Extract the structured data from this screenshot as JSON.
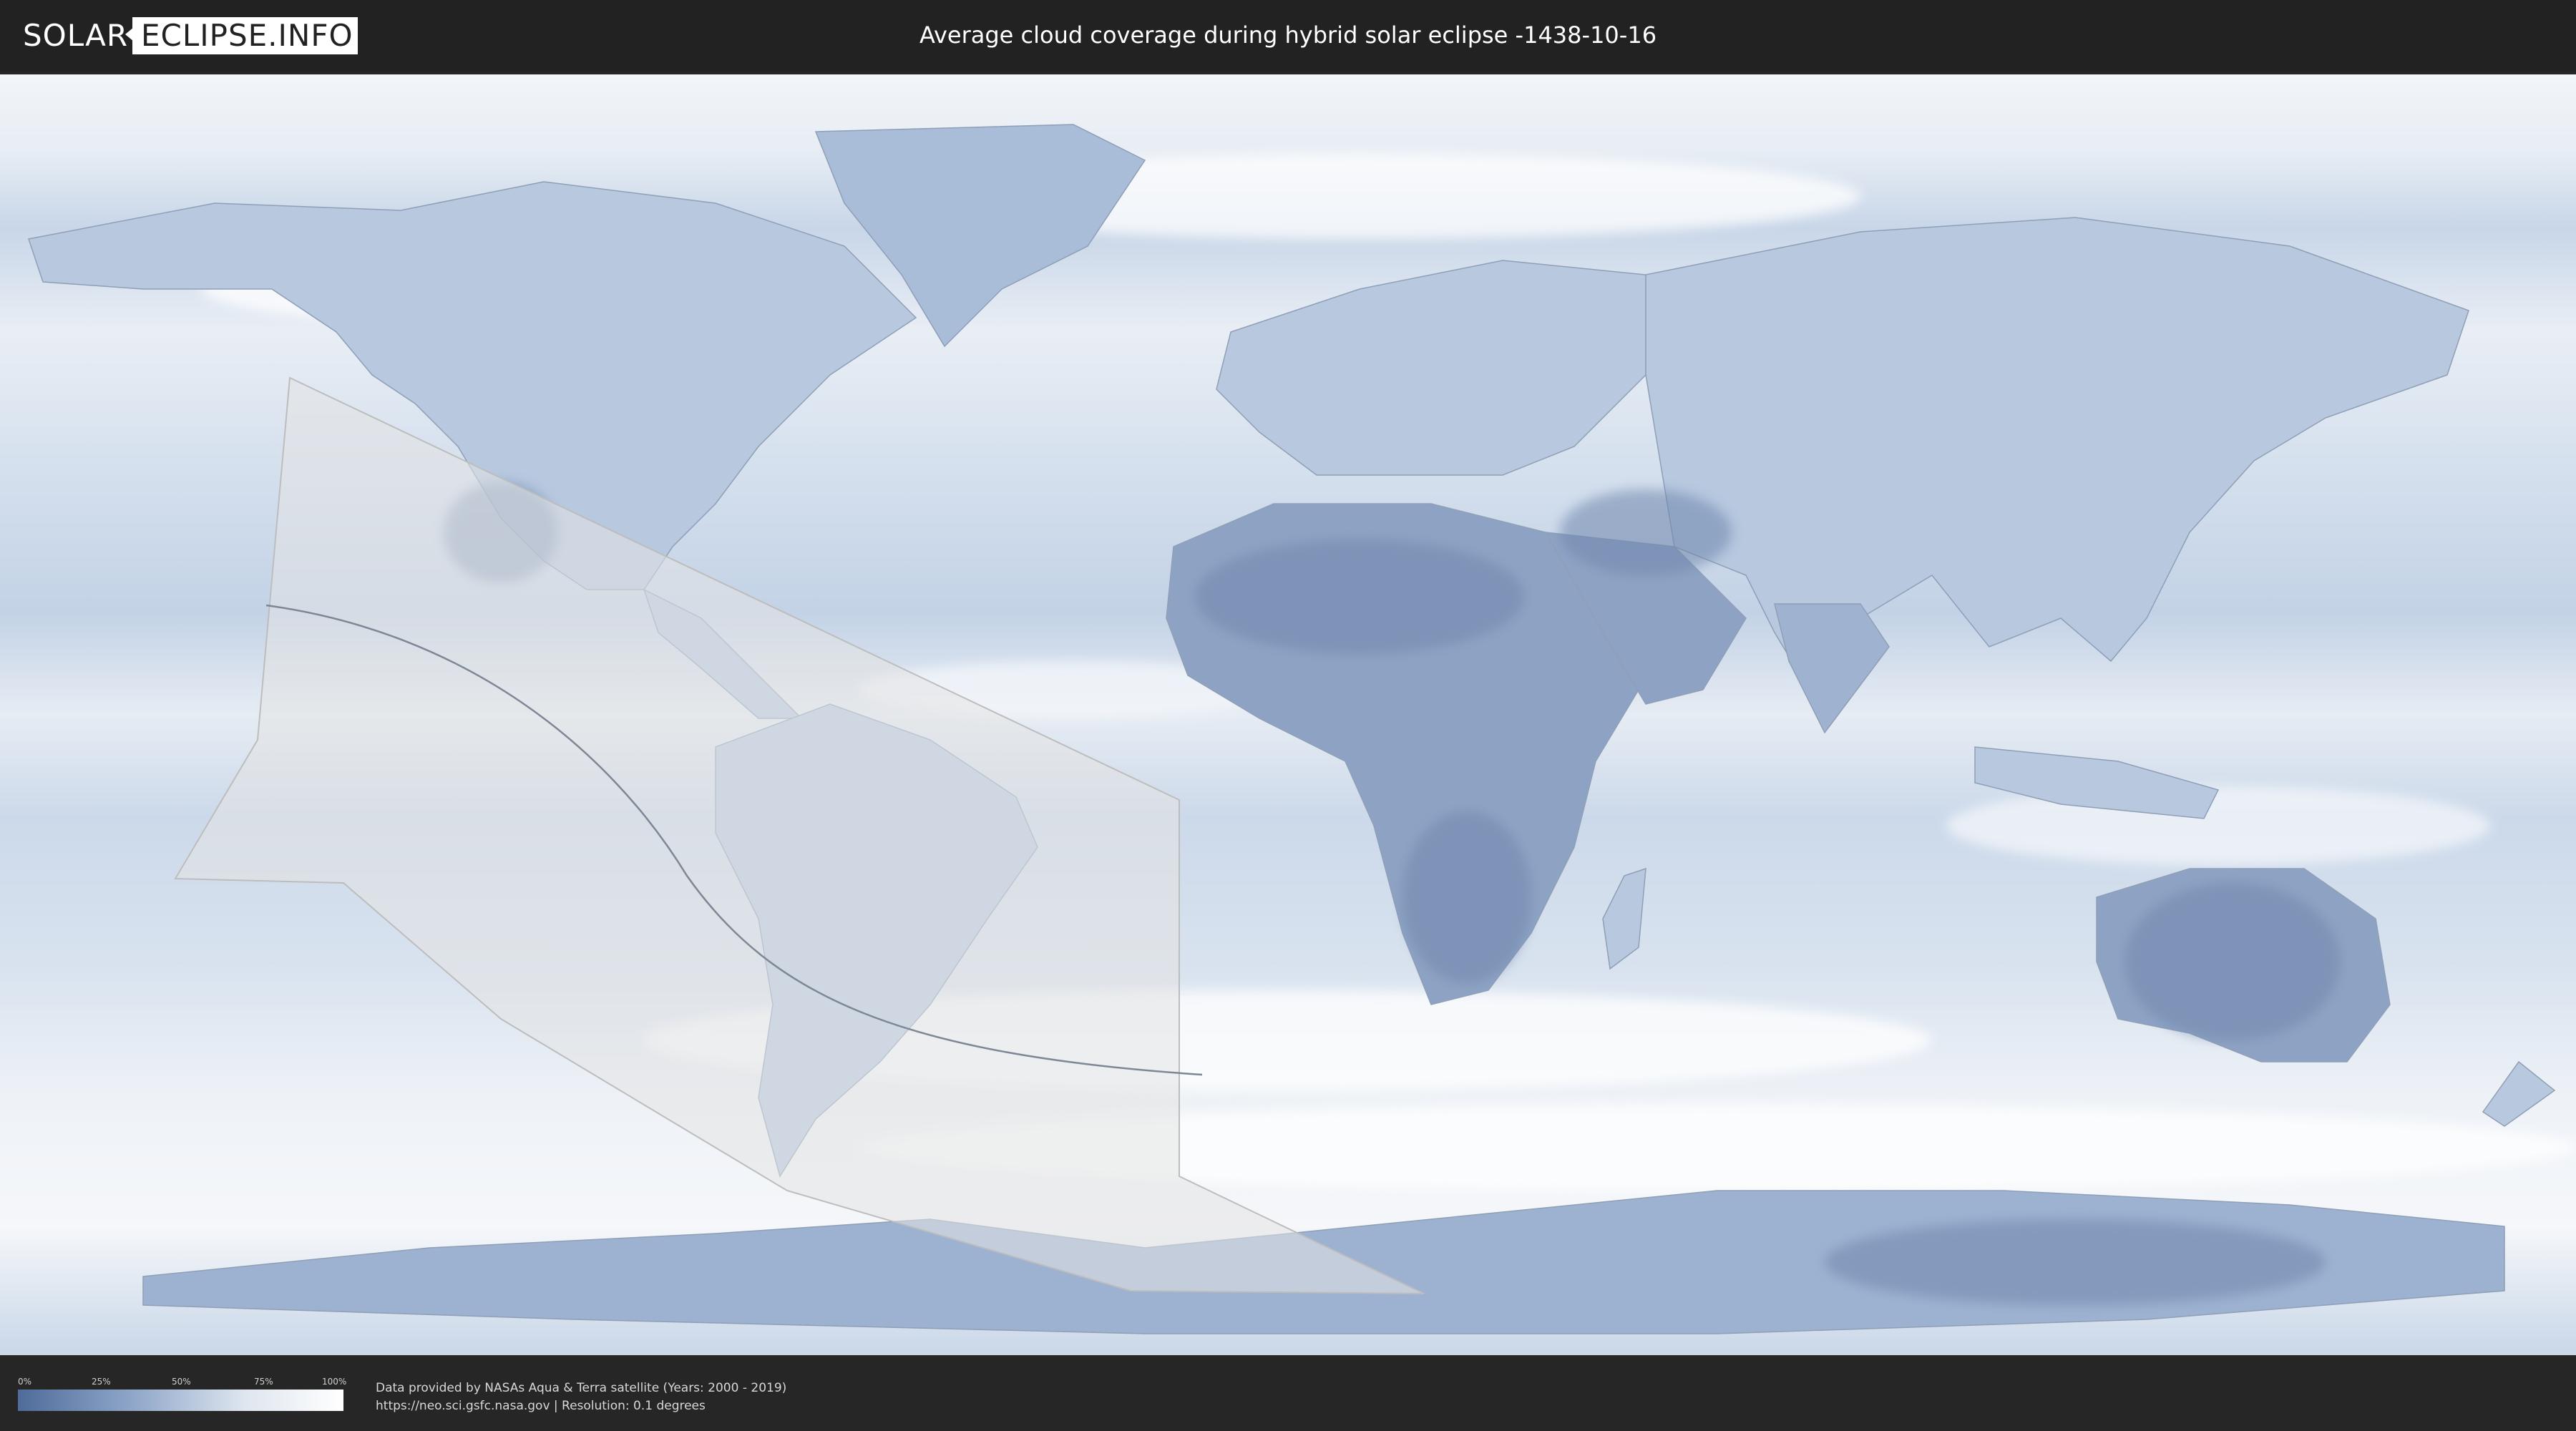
{
  "header": {
    "logo_left": "SOLAR",
    "logo_right": "ECLIPSE.INFO",
    "title": "Average cloud coverage during hybrid solar eclipse -1438-10-16"
  },
  "colors": {
    "header_bg": "#222222",
    "ocean_cloud": "#cfdbe9",
    "clear_sky": "#4f6b99",
    "full_cloud": "#ffffff",
    "eclipse_zone": "#e4e4e4"
  },
  "legend": {
    "ticks": [
      "0%",
      "25%",
      "50%",
      "75%",
      "100%"
    ]
  },
  "footer": {
    "credit_line1": "Data provided by NASAs Aqua & Terra satellite (Years: 2000 - 2019)",
    "credit_line2": "https://neo.sci.gsfc.nasa.gov | Resolution: 0.1 degrees"
  }
}
